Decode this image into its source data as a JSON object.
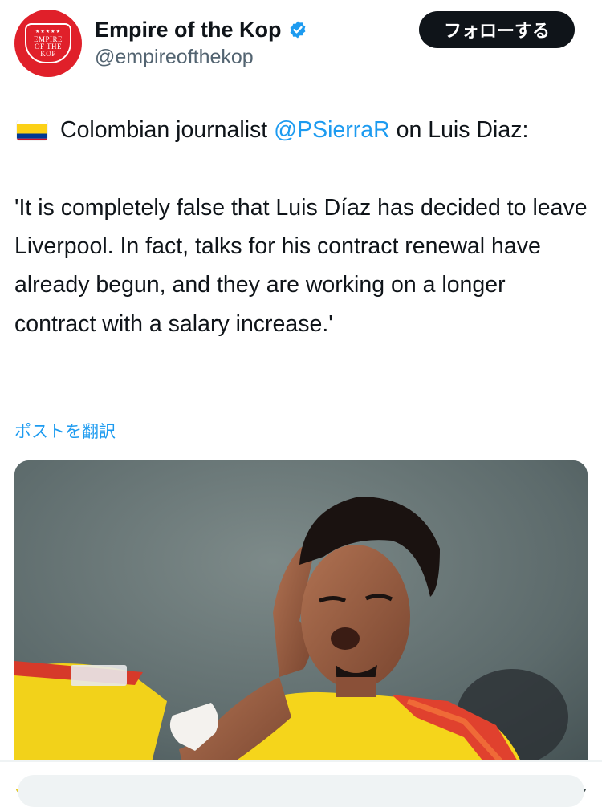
{
  "author": {
    "display_name": "Empire of the Kop",
    "handle": "@empireofthekop",
    "avatar_text": [
      "EMPIRE",
      "OF THE",
      "KOP"
    ],
    "avatar_stars": "★★★★★",
    "verified": true
  },
  "follow_button": {
    "label": "フォローする"
  },
  "tweet": {
    "flag_icon": "colombia-flag",
    "intro_text": "Colombian journalist",
    "mention": "@PSierraR",
    "intro_suffix": "on Luis Diaz:",
    "quote": "'It is completely false that Luis Díaz has decided to leave Liverpool. In fact, talks for his contract renewal have already begun, and they are working on a longer contract with a salary increase.'"
  },
  "translate_link": {
    "label": "ポストを翻訳"
  },
  "colors": {
    "accent": "#1d9bf0",
    "text": "#0f1419",
    "secondary": "#536471",
    "avatar_bg": "#e0202a",
    "follow_bg": "#0f1419"
  }
}
